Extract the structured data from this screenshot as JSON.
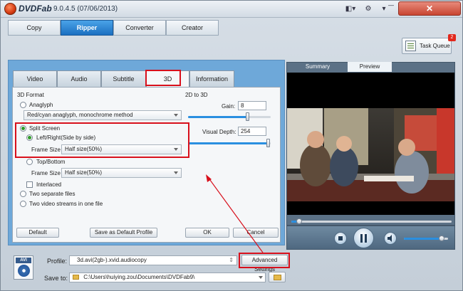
{
  "window": {
    "logo_text": "DVDFab",
    "version": "9.0.4.5 (07/06/2013)",
    "controls": [
      "◧▾",
      "⚙",
      "▾",
      "—",
      "✕"
    ]
  },
  "nav": {
    "tabs": [
      {
        "label": "Copy",
        "active": false
      },
      {
        "label": "Ripper",
        "active": true
      },
      {
        "label": "Converter",
        "active": false
      },
      {
        "label": "Creator",
        "active": false
      }
    ]
  },
  "task_queue": {
    "label": "Task Queue",
    "badge": "2"
  },
  "settings": {
    "tabs": [
      {
        "label": "Video"
      },
      {
        "label": "Audio"
      },
      {
        "label": "Subtitle"
      },
      {
        "label": "3D"
      },
      {
        "label": "Information"
      }
    ],
    "format_heading": "3D Format",
    "anaglyph_label": "Anaglyph",
    "anaglyph_method": "Red/cyan anaglyph, monochrome method",
    "split_screen_label": "Split Screen",
    "left_right_label": "Left/Right(Side by side)",
    "frame_size_label": "Frame Size",
    "frame_size_value": "Half size(50%)",
    "top_bottom_label": "Top/Bottom",
    "frame_size_label_2": "Frame Size",
    "frame_size_value_2": "Half size(50%)",
    "interlaced_label": "Interlaced",
    "two_files_label": "Two separate files",
    "two_streams_label": "Two video streams in one file",
    "to3d_heading": "2D to 3D",
    "gain_label": "Gain:",
    "gain_value": "8",
    "gain_level": 0.72,
    "depth_label": "Visual Depth:",
    "depth_value": "254",
    "depth_level": 0.97,
    "default_btn": "Default",
    "save_default_btn": "Save as Default Profile",
    "ok_btn": "OK",
    "cancel_btn": "Cancel"
  },
  "preview": {
    "tabs": [
      {
        "label": "Summary",
        "active": false
      },
      {
        "label": "Preview",
        "active": true
      }
    ],
    "progress": 0.05,
    "volume": 0.85
  },
  "bottom": {
    "icon_tag": "AVI",
    "profile_label": "Profile:",
    "profile_value": "3d.avi(2gb-).xvid.audiocopy",
    "advanced_btn": "Advanced Settings",
    "save_to_label": "Save to:",
    "save_to_value": "C:\\Users\\huiying.zou\\Documents\\DVDFab9\\"
  },
  "colors": {
    "accent_blue": "#1b6fc0",
    "annotation_red": "#d8101c",
    "slider_fill": "#2a8fe0",
    "radio_on": "#2f9a2a"
  }
}
